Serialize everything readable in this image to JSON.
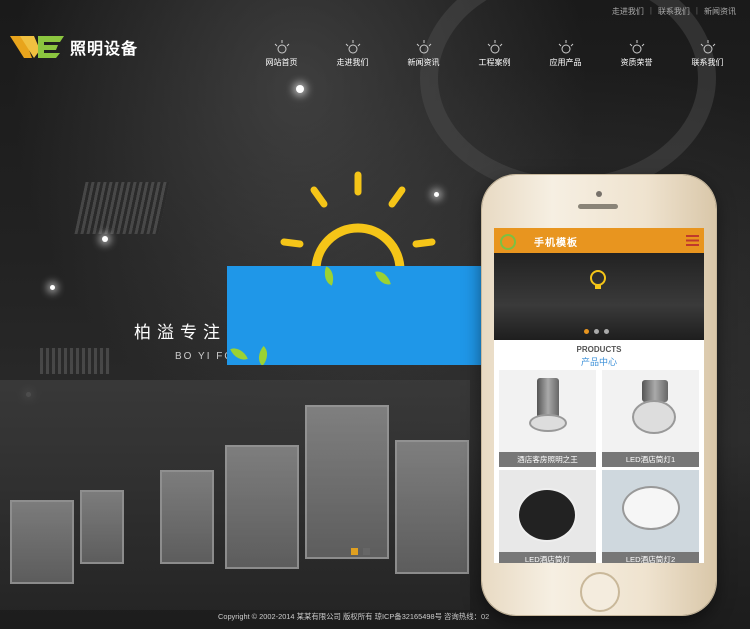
{
  "top_links": [
    "走进我们",
    "联系我们",
    "新闻资讯"
  ],
  "logo": {
    "text": "照明设备"
  },
  "nav": {
    "items": [
      "网站首页",
      "走进我们",
      "新闻资讯",
      "工程案例",
      "应用产品",
      "资质荣誉",
      "联系我们"
    ]
  },
  "hero": {
    "slogan": "柏溢专注",
    "slogan_en": "BO YI FO"
  },
  "mobile": {
    "header_title": "手机模板",
    "products_en": "PRODUCTS",
    "products_zh": "产品中心",
    "products": [
      {
        "name": "酒店客房照明之王"
      },
      {
        "name": "LED酒店筒灯1"
      },
      {
        "name": "LED酒店筒灯"
      },
      {
        "name": "LED酒店筒灯2"
      }
    ]
  },
  "footer": {
    "text": "Copyright © 2002-2014 某某有限公司 版权所有 琼ICP备32165498号 咨询热线：02"
  },
  "colors": {
    "accent": "#e8951f",
    "banner_blue": "#1f97e8",
    "leaf": "#9bd233"
  },
  "icons": [
    "lamp-icon",
    "menu-icon",
    "sun-icon"
  ]
}
